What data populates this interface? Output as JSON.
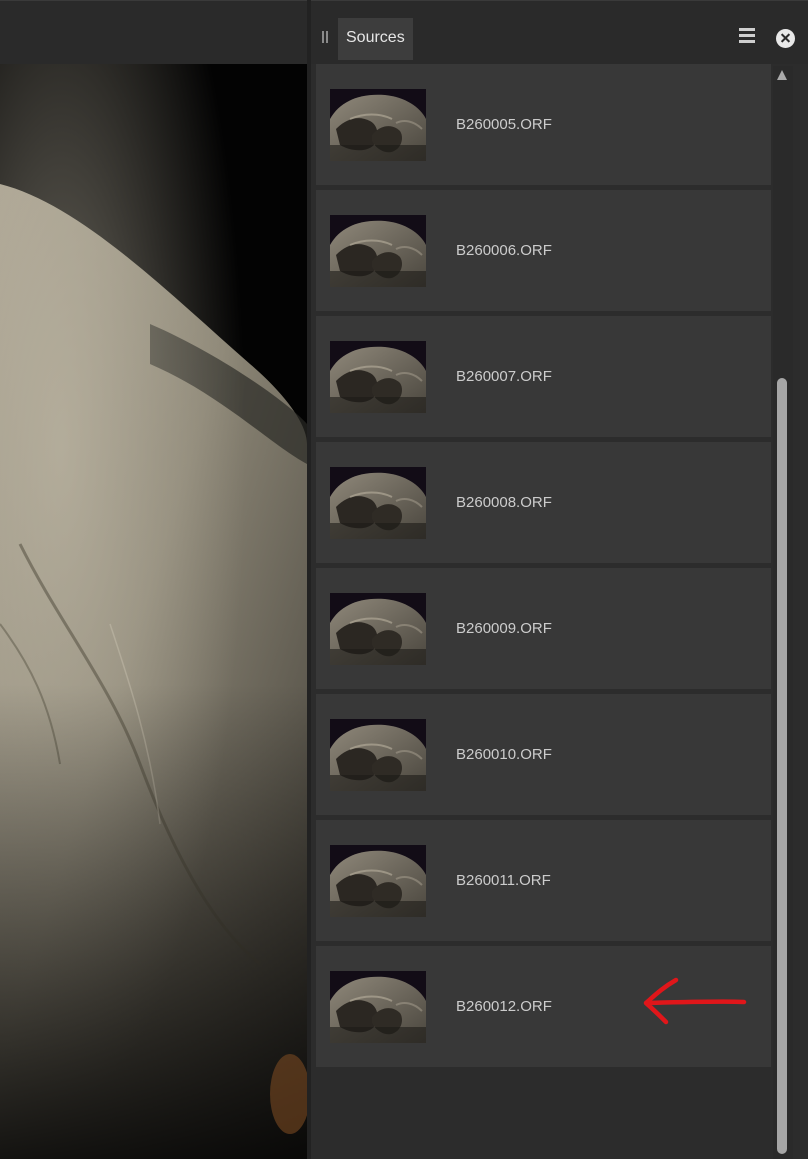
{
  "panel": {
    "tab_label": "Sources"
  },
  "sources": [
    {
      "name": "B260005.ORF"
    },
    {
      "name": "B260006.ORF"
    },
    {
      "name": "B260007.ORF"
    },
    {
      "name": "B260008.ORF"
    },
    {
      "name": "B260009.ORF"
    },
    {
      "name": "B260010.ORF"
    },
    {
      "name": "B260011.ORF"
    },
    {
      "name": "B260012.ORF"
    }
  ],
  "annotation": {
    "color": "#e0161a",
    "points_to": "B260012.ORF"
  },
  "icons": [
    "grip-icon",
    "menu-icon",
    "close-icon",
    "scroll-up-arrow-icon",
    "red-arrow-icon"
  ]
}
